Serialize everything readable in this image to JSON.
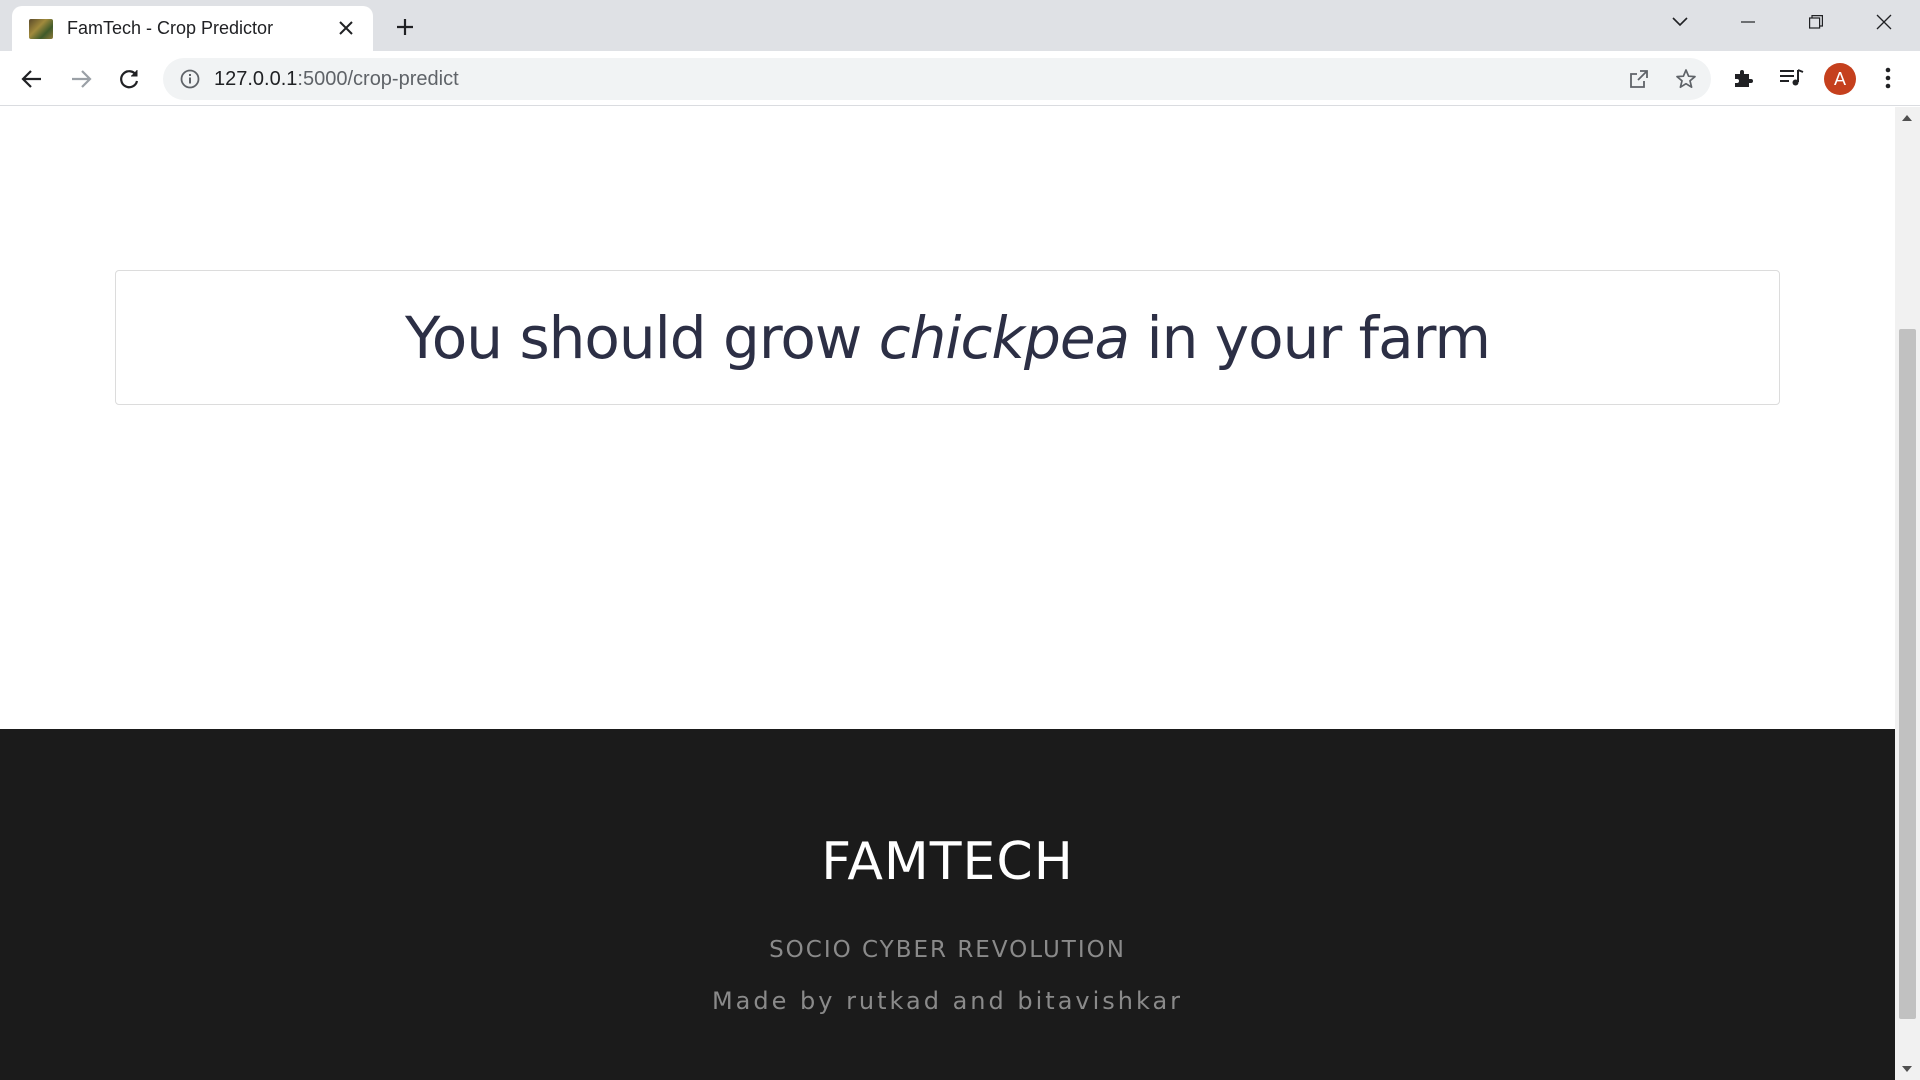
{
  "browser": {
    "tab_title": "FamTech - Crop Predictor",
    "url_host": "127.0.0.1",
    "url_path": ":5000/crop-predict",
    "profile_initial": "A"
  },
  "result": {
    "prefix": "You should grow ",
    "crop": "chickpea",
    "suffix": " in your farm"
  },
  "footer": {
    "brand": "FAMTECH",
    "tagline": "SOCIO CYBER REVOLUTION",
    "credit": "Made by rutkad and bitavishkar"
  },
  "colors": {
    "footer_bg": "#1b1b1b",
    "text_dark": "#2c2f45",
    "avatar": "#c5401d"
  },
  "scroll": {
    "position_fraction": 0.24
  }
}
